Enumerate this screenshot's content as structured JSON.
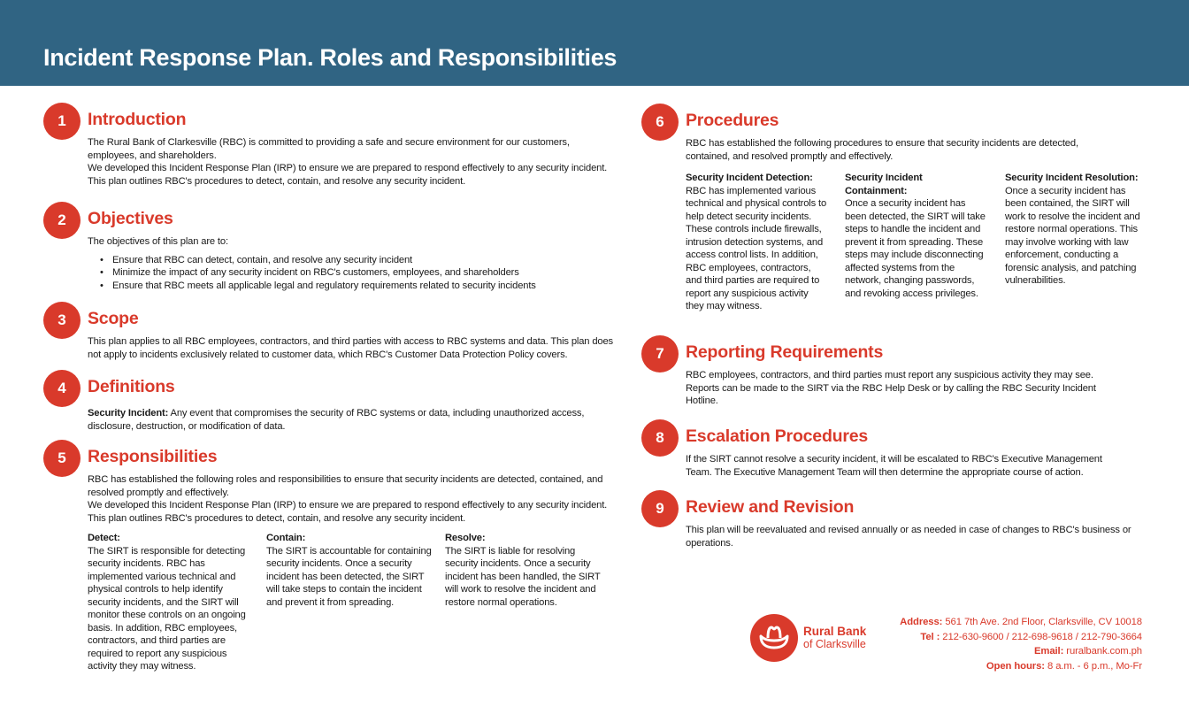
{
  "header": {
    "title": "Incident Response Plan. Roles and Responsibilities"
  },
  "colors": {
    "header_bg": "#306483",
    "accent": "#d93a2b",
    "text": "#1a1a1a"
  },
  "sections": [
    {
      "number": "1",
      "title": "Introduction",
      "paragraphs": [
        "The Rural Bank of Clarkesville (RBC) is committed to providing a safe and secure environment for our customers, employees, and shareholders.",
        "We developed this Incident Response Plan (IRP) to ensure we are prepared to respond effectively to any security incident. This plan outlines RBC's procedures to detect, contain, and resolve any security incident."
      ]
    },
    {
      "number": "2",
      "title": "Objectives",
      "paragraphs": [
        "The objectives of this plan are to:"
      ],
      "bullets": [
        "Ensure that RBC can detect, contain, and resolve any security incident",
        "Minimize the impact of any security incident on RBC's customers, employees, and shareholders",
        "Ensure that RBC meets all applicable legal and regulatory requirements related to security incidents"
      ]
    },
    {
      "number": "3",
      "title": "Scope",
      "paragraphs": [
        "This plan applies to all RBC employees, contractors, and third parties with access to RBC systems and data. This plan does not apply to incidents exclusively related to customer data, which RBC's Customer Data Protection Policy covers."
      ]
    },
    {
      "number": "4",
      "title": "Definitions",
      "term": "Security Incident:",
      "definition": " Any event that compromises the security of RBC systems or data, including unauthorized access, disclosure, destruction, or modification of data."
    },
    {
      "number": "5",
      "title": "Responsibilities",
      "paragraphs": [
        "RBC has established the following roles and responsibilities to ensure that security incidents are detected, contained, and resolved promptly and effectively.",
        "We developed this Incident Response Plan (IRP) to ensure we are prepared to respond effectively to any security incident. This plan outlines RBC's procedures to detect, contain, and resolve any security incident."
      ],
      "columns": [
        {
          "title": "Detect:",
          "text": "The SIRT is responsible for detecting security incidents. RBC has implemented various technical and physical controls to help identify security incidents, and the SIRT will monitor these controls on an ongoing basis. In addition, RBC employees, contractors, and third parties are required to report any suspicious activity they may witness."
        },
        {
          "title": "Contain:",
          "text": "The SIRT is accountable for containing security incidents. Once a security incident has been detected, the SIRT will take steps to contain the incident and prevent it from spreading."
        },
        {
          "title": "Resolve:",
          "text": "The SIRT is liable for resolving security incidents. Once a security incident has been handled, the SIRT will work to resolve the incident and restore normal operations."
        }
      ]
    },
    {
      "number": "6",
      "title": "Procedures",
      "paragraphs": [
        "RBC has established the following procedures to ensure that security incidents are detected, contained, and resolved promptly and effectively."
      ],
      "columns": [
        {
          "title": "Security Incident Detection:",
          "text": "RBC has implemented various technical and physical controls to help detect security incidents. These controls include firewalls, intrusion detection systems, and access control lists. In addition, RBC employees, contractors, and third parties are required to report any suspicious activity they may witness."
        },
        {
          "title": "Security Incident Containment:",
          "text": "Once a security incident has been detected, the SIRT will take steps to handle the incident and prevent it from spreading. These steps may include disconnecting affected systems from the network, changing passwords, and revoking access privileges."
        },
        {
          "title": "Security Incident Resolution:",
          "text": "Once a security incident has been contained, the SIRT will work to resolve the incident and restore normal operations. This may involve working with law enforcement, conducting a forensic analysis, and patching vulnerabilities."
        }
      ]
    },
    {
      "number": "7",
      "title": "Reporting Requirements",
      "paragraphs": [
        "RBC employees, contractors, and third parties must report any suspicious activity they may see. Reports can be made to the SIRT via the RBC Help Desk or by calling the RBC Security Incident Hotline."
      ]
    },
    {
      "number": "8",
      "title": "Escalation Procedures",
      "paragraphs": [
        "If the SIRT cannot resolve a security incident, it will be escalated to RBC's Executive Management Team. The Executive Management Team will then determine the appropriate course of action."
      ]
    },
    {
      "number": "9",
      "title": "Review and Revision",
      "paragraphs": [
        "This plan will be reevaluated and revised annually or as needed in case of changes to RBC's business or operations."
      ]
    }
  ],
  "footer": {
    "logo_icon": "cowboy-hat-icon",
    "brand_name": "Rural Bank",
    "brand_sub": "of Clarksville",
    "address_label": "Address:",
    "address_value": " 561 7th Ave. 2nd Floor, Clarksville, CV 10018",
    "tel_label": "Tel :",
    "tel_value": " 212-630-9600 / 212-698-9618 / 212-790-3664",
    "email_label": "Email:",
    "email_value": " ruralbank.com.ph",
    "hours_label": "Open hours:",
    "hours_value": " 8 a.m. - 6 p.m., Mo-Fr"
  }
}
